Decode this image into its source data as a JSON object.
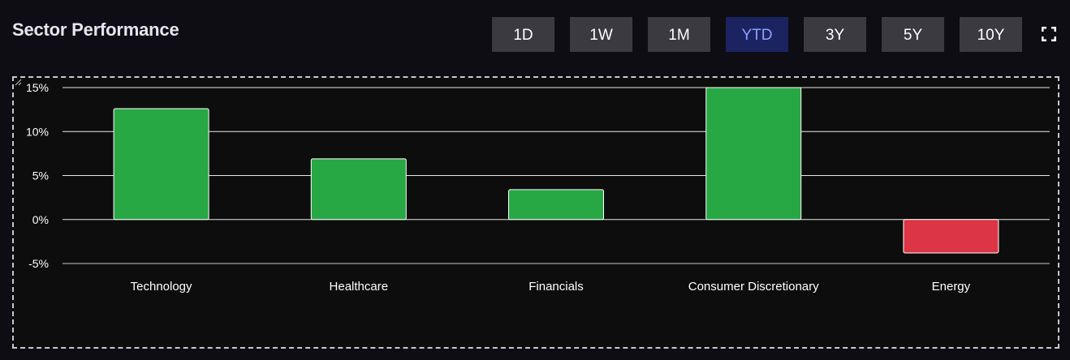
{
  "header": {
    "title": "Sector Performance"
  },
  "range_buttons": [
    {
      "label": "1D",
      "active": false
    },
    {
      "label": "1W",
      "active": false
    },
    {
      "label": "1M",
      "active": false
    },
    {
      "label": "YTD",
      "active": true
    },
    {
      "label": "3Y",
      "active": false
    },
    {
      "label": "5Y",
      "active": false
    },
    {
      "label": "10Y",
      "active": false
    }
  ],
  "icons": {
    "fullscreen": "fullscreen-icon",
    "resize": "resize-grip-icon"
  },
  "colors": {
    "positive": "#28a745",
    "negative": "#dc3545",
    "active_button_bg": "#1b2360",
    "active_button_text": "#8da3ff"
  },
  "chart_data": {
    "type": "bar",
    "categories": [
      "Technology",
      "Healthcare",
      "Financials",
      "Consumer Discretionary",
      "Energy"
    ],
    "values": [
      12.6,
      6.9,
      3.4,
      15.0,
      -3.8
    ],
    "ylim": [
      -5,
      15
    ],
    "yticks": [
      15,
      10,
      5,
      0,
      -5
    ],
    "ytick_labels": [
      "15%",
      "10%",
      "5%",
      "0%",
      "-5%"
    ],
    "grid": true,
    "title": "",
    "xlabel": "",
    "ylabel": ""
  }
}
